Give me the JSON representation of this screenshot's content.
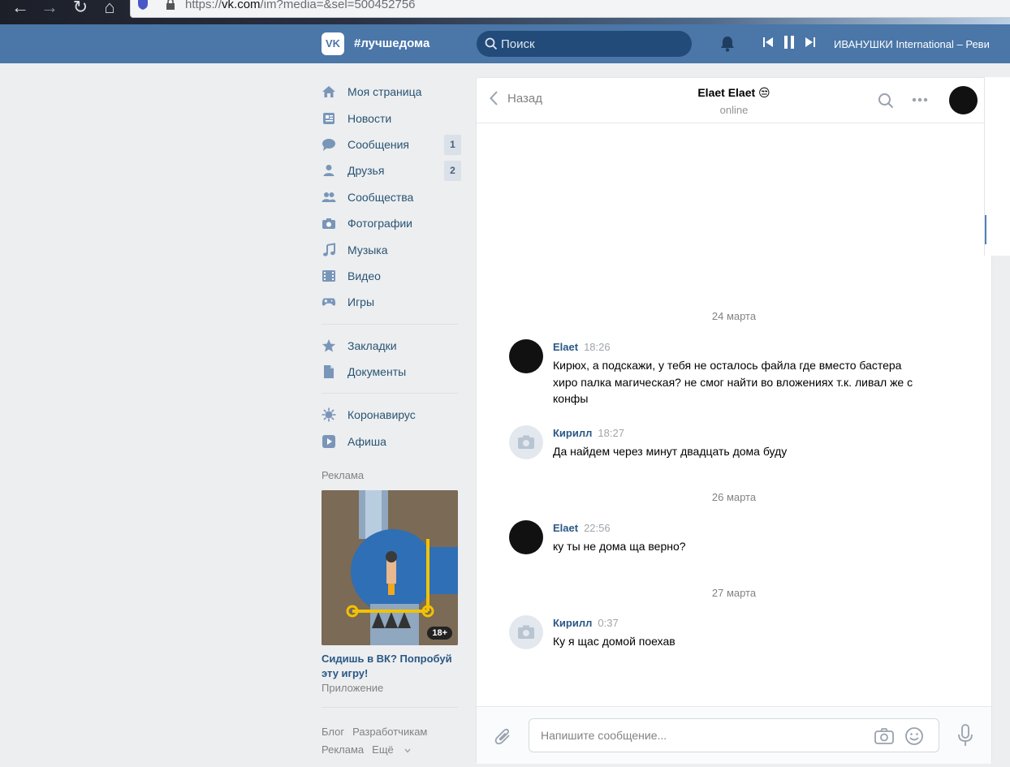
{
  "browser": {
    "url_prefix": "https://",
    "url_host": "vk.com",
    "url_path": "/im?media=&sel=500452756"
  },
  "header": {
    "logo_text": "VK",
    "brand": "#лучшедома",
    "search_placeholder": "Поиск",
    "now_playing": "ИВАНУШКИ International – Реви"
  },
  "sidebar": {
    "items": [
      {
        "label": "Моя страница",
        "icon": "home-icon"
      },
      {
        "label": "Новости",
        "icon": "news-icon"
      },
      {
        "label": "Сообщения",
        "icon": "messages-icon",
        "count": "1"
      },
      {
        "label": "Друзья",
        "icon": "friends-icon",
        "count": "2"
      },
      {
        "label": "Сообщества",
        "icon": "communities-icon"
      },
      {
        "label": "Фотографии",
        "icon": "camera-icon"
      },
      {
        "label": "Музыка",
        "icon": "music-icon"
      },
      {
        "label": "Видео",
        "icon": "video-icon"
      },
      {
        "label": "Игры",
        "icon": "gamepad-icon"
      }
    ],
    "items2": [
      {
        "label": "Закладки",
        "icon": "star-icon"
      },
      {
        "label": "Документы",
        "icon": "document-icon"
      }
    ],
    "items3": [
      {
        "label": "Коронавирус",
        "icon": "virus-icon"
      },
      {
        "label": "Афиша",
        "icon": "play-icon"
      }
    ],
    "ad": {
      "title": "Реклама",
      "badge": "18+",
      "caption": "Сидишь в ВК? Попробуй эту игру!",
      "sub": "Приложение"
    },
    "footer": [
      "Блог",
      "Разработчикам",
      "Реклама",
      "Ещё"
    ]
  },
  "chat": {
    "back_label": "Назад",
    "peer_name": "Elaet Elaet 😒",
    "peer_status": "online",
    "dates": [
      "24 марта",
      "26 марта",
      "27 марта"
    ],
    "messages": [
      {
        "author": "Elaet",
        "time": "18:26",
        "text": "Кирюх, а подскажи, у тебя не осталось файла где вместо бастера хиро палка магическая? не смог найти во вложениях т.к. ливал же с конфы"
      },
      {
        "author": "Кирилл",
        "time": "18:27",
        "text": "Да найдем через минут двадцать дома буду"
      },
      {
        "author": "Elaet",
        "time": "22:56",
        "text": "ку ты не дома ща верно?"
      },
      {
        "author": "Кирилл",
        "time": "0:37",
        "text": "Ку я щас домой поехав"
      }
    ],
    "compose_placeholder": "Напишите сообщение..."
  },
  "colors": {
    "header_bg": "#4a76a8",
    "link": "#2a5885",
    "page_bg": "#edeef0"
  }
}
